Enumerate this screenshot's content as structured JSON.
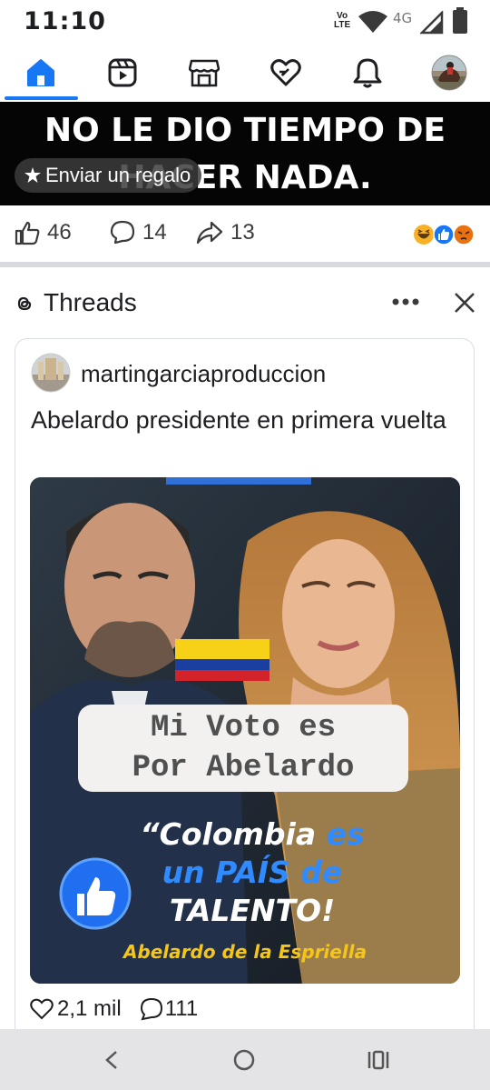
{
  "status_bar": {
    "time": "11:10",
    "volte_top": "Vo",
    "volte_bottom": "LTE",
    "network": "4G",
    "icons": [
      "wifi-icon",
      "signal-icon",
      "battery-icon"
    ]
  },
  "nav": {
    "tabs": [
      "home-icon",
      "reels-icon",
      "marketplace-icon",
      "dating-icon",
      "notifications-icon",
      "profile-avatar"
    ],
    "active": "home-icon",
    "accent": "#1877f2"
  },
  "video": {
    "caption_line1": "NO LE DIO TIEMPO DE",
    "caption_line2": "HACER NADA.",
    "gift_label": "Enviar un regalo"
  },
  "reactions": {
    "likes": "46",
    "comments": "14",
    "shares": "13",
    "emojis": [
      "haha",
      "like",
      "angry"
    ]
  },
  "threads": {
    "source_label": "Threads",
    "more_icon": "more-icon",
    "close_icon": "close-icon"
  },
  "post": {
    "username": "martingarciaproduccion",
    "text": "Abelardo presidente en primera vuelta",
    "image": {
      "vote_line1": "Mi Voto es",
      "vote_line2": "Por Abelardo",
      "quote_open": "“",
      "quote_w1": "Colombia",
      "quote_w2": "es",
      "quote_w3": "un",
      "quote_w4": "PAÍS",
      "quote_w5": "de",
      "quote_w6": "TALENTO!",
      "signature": "Abelardo de la Espriella"
    },
    "likes": "2,1 mil",
    "comments": "111"
  }
}
